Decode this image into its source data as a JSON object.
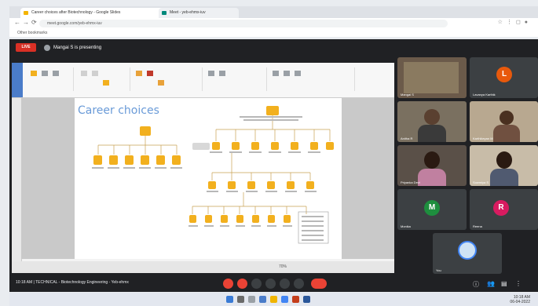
{
  "browser": {
    "tabs": [
      {
        "title": "Career choices after Biotechnology - Google Slides"
      },
      {
        "title": "Meet - yeb-ehmx-iuv"
      }
    ],
    "url": "meet.google.com/yeb-ehmx-iuv",
    "bookmarks_label": "Other bookmarks"
  },
  "meet": {
    "live_label": "LIVE",
    "presenter_label": "Mangai S is presenting",
    "meeting_info": "10:18 AM  |  TECHNICAL - Biotechnology Engineering - Yeb-ehmx",
    "zoom_label": "70%"
  },
  "slide": {
    "title": "Career choices"
  },
  "participants": [
    {
      "name": "Mangai S"
    },
    {
      "initial": "L",
      "name": "Lavanya Karthik",
      "color": "#e8590c"
    },
    {
      "name": "Anitha R"
    },
    {
      "name": "Karthikeyan M"
    },
    {
      "name": "Priyanka Devi"
    },
    {
      "name": "Sowmiya S"
    },
    {
      "initial": "M",
      "name": "Monika",
      "color": "#1e8e3e"
    },
    {
      "initial": "R",
      "name": "Reena",
      "color": "#d81b60"
    },
    {
      "name": "You"
    }
  ],
  "taskbar": {
    "time": "10:18 AM",
    "date": "06-04-2022"
  },
  "colors": {
    "accent": "#ea4335",
    "meet_bg": "#202124",
    "tile_bg": "#3c4043",
    "slide_title": "#6a9bd8",
    "chart_node": "#f2b01e"
  }
}
